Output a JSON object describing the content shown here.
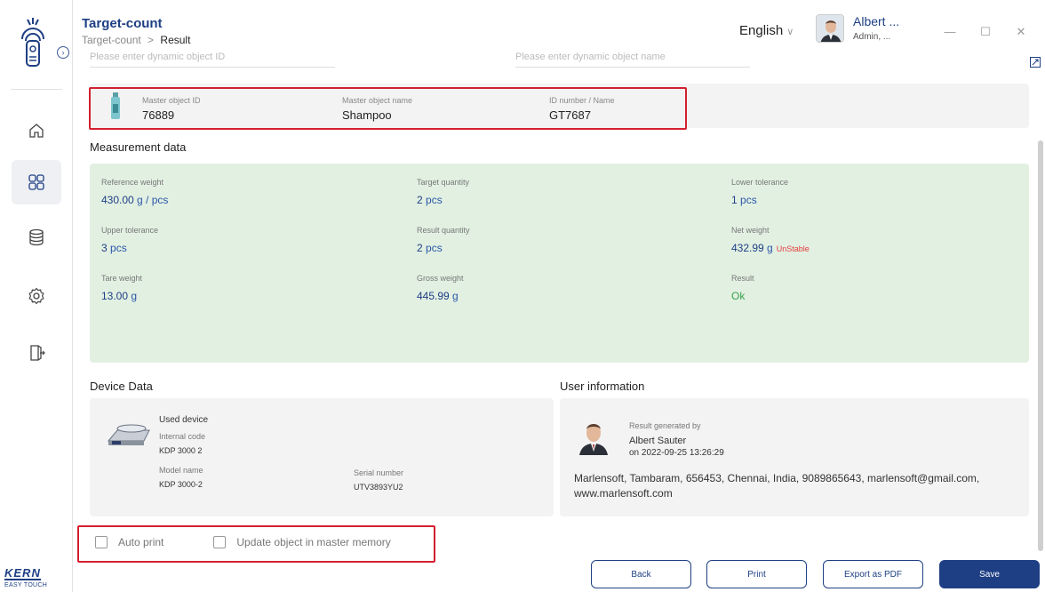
{
  "header": {
    "title": "Target-count",
    "breadcrumb": {
      "parent": "Target-count",
      "separator": ">",
      "current": "Result"
    },
    "language": "English",
    "user_name": "Albert ...",
    "user_role": "Admin, ..."
  },
  "brand": {
    "name": "KERN",
    "sub": "EASY TOUCH"
  },
  "dynamic_object": {
    "id_placeholder": "Please enter dynamic object ID",
    "name_placeholder": "Please enter dynamic object name"
  },
  "master_object": {
    "id_label": "Master object ID",
    "id_value": "76889",
    "name_label": "Master object name",
    "name_value": "Shampoo",
    "idnum_label": "ID number / Name",
    "idnum_value": "GT7687"
  },
  "measurement": {
    "title": "Measurement data",
    "reference_weight": {
      "label": "Reference weight",
      "value": "430.00",
      "unit": "g / pcs"
    },
    "target_quantity": {
      "label": "Target quantity",
      "value": "2",
      "unit": "pcs"
    },
    "lower_tolerance": {
      "label": "Lower tolerance",
      "value": "1",
      "unit": "pcs"
    },
    "upper_tolerance": {
      "label": "Upper tolerance",
      "value": "3",
      "unit": "pcs"
    },
    "result_quantity": {
      "label": "Result quantity",
      "value": "2",
      "unit": "pcs"
    },
    "net_weight": {
      "label": "Net weight",
      "value": "432.99",
      "unit": "g",
      "status": "UnStable"
    },
    "tare_weight": {
      "label": "Tare weight",
      "value": "13.00",
      "unit": "g"
    },
    "gross_weight": {
      "label": "Gross weight",
      "value": "445.99",
      "unit": "g"
    },
    "result": {
      "label": "Result",
      "value": "Ok"
    }
  },
  "device": {
    "title": "Device Data",
    "used_device": "Used device",
    "internal_code_label": "Internal code",
    "internal_code": "KDP 3000 2",
    "model_label": "Model name",
    "model": "KDP 3000-2",
    "serial_label": "Serial number",
    "serial": "UTV3893YU2"
  },
  "user_info": {
    "title": "User information",
    "generated_label": "Result generated by",
    "name": "Albert Sauter",
    "date": "on 2022-09-25 13:26:29",
    "address": "Marlensoft, Tambaram, 656453, Chennai, India, 9089865643, marlensoft@gmail.com, www.marlensoft.com"
  },
  "options": {
    "auto_print": "Auto print",
    "update_master": "Update object in master memory"
  },
  "buttons": {
    "back": "Back",
    "print": "Print",
    "export": "Export as PDF",
    "save": "Save"
  },
  "colors": {
    "brand": "#1e3f84",
    "highlight": "#d3202f",
    "measure_bg": "#e2f0e2",
    "ok": "#3aa24a",
    "unstable": "#e53e3e"
  }
}
